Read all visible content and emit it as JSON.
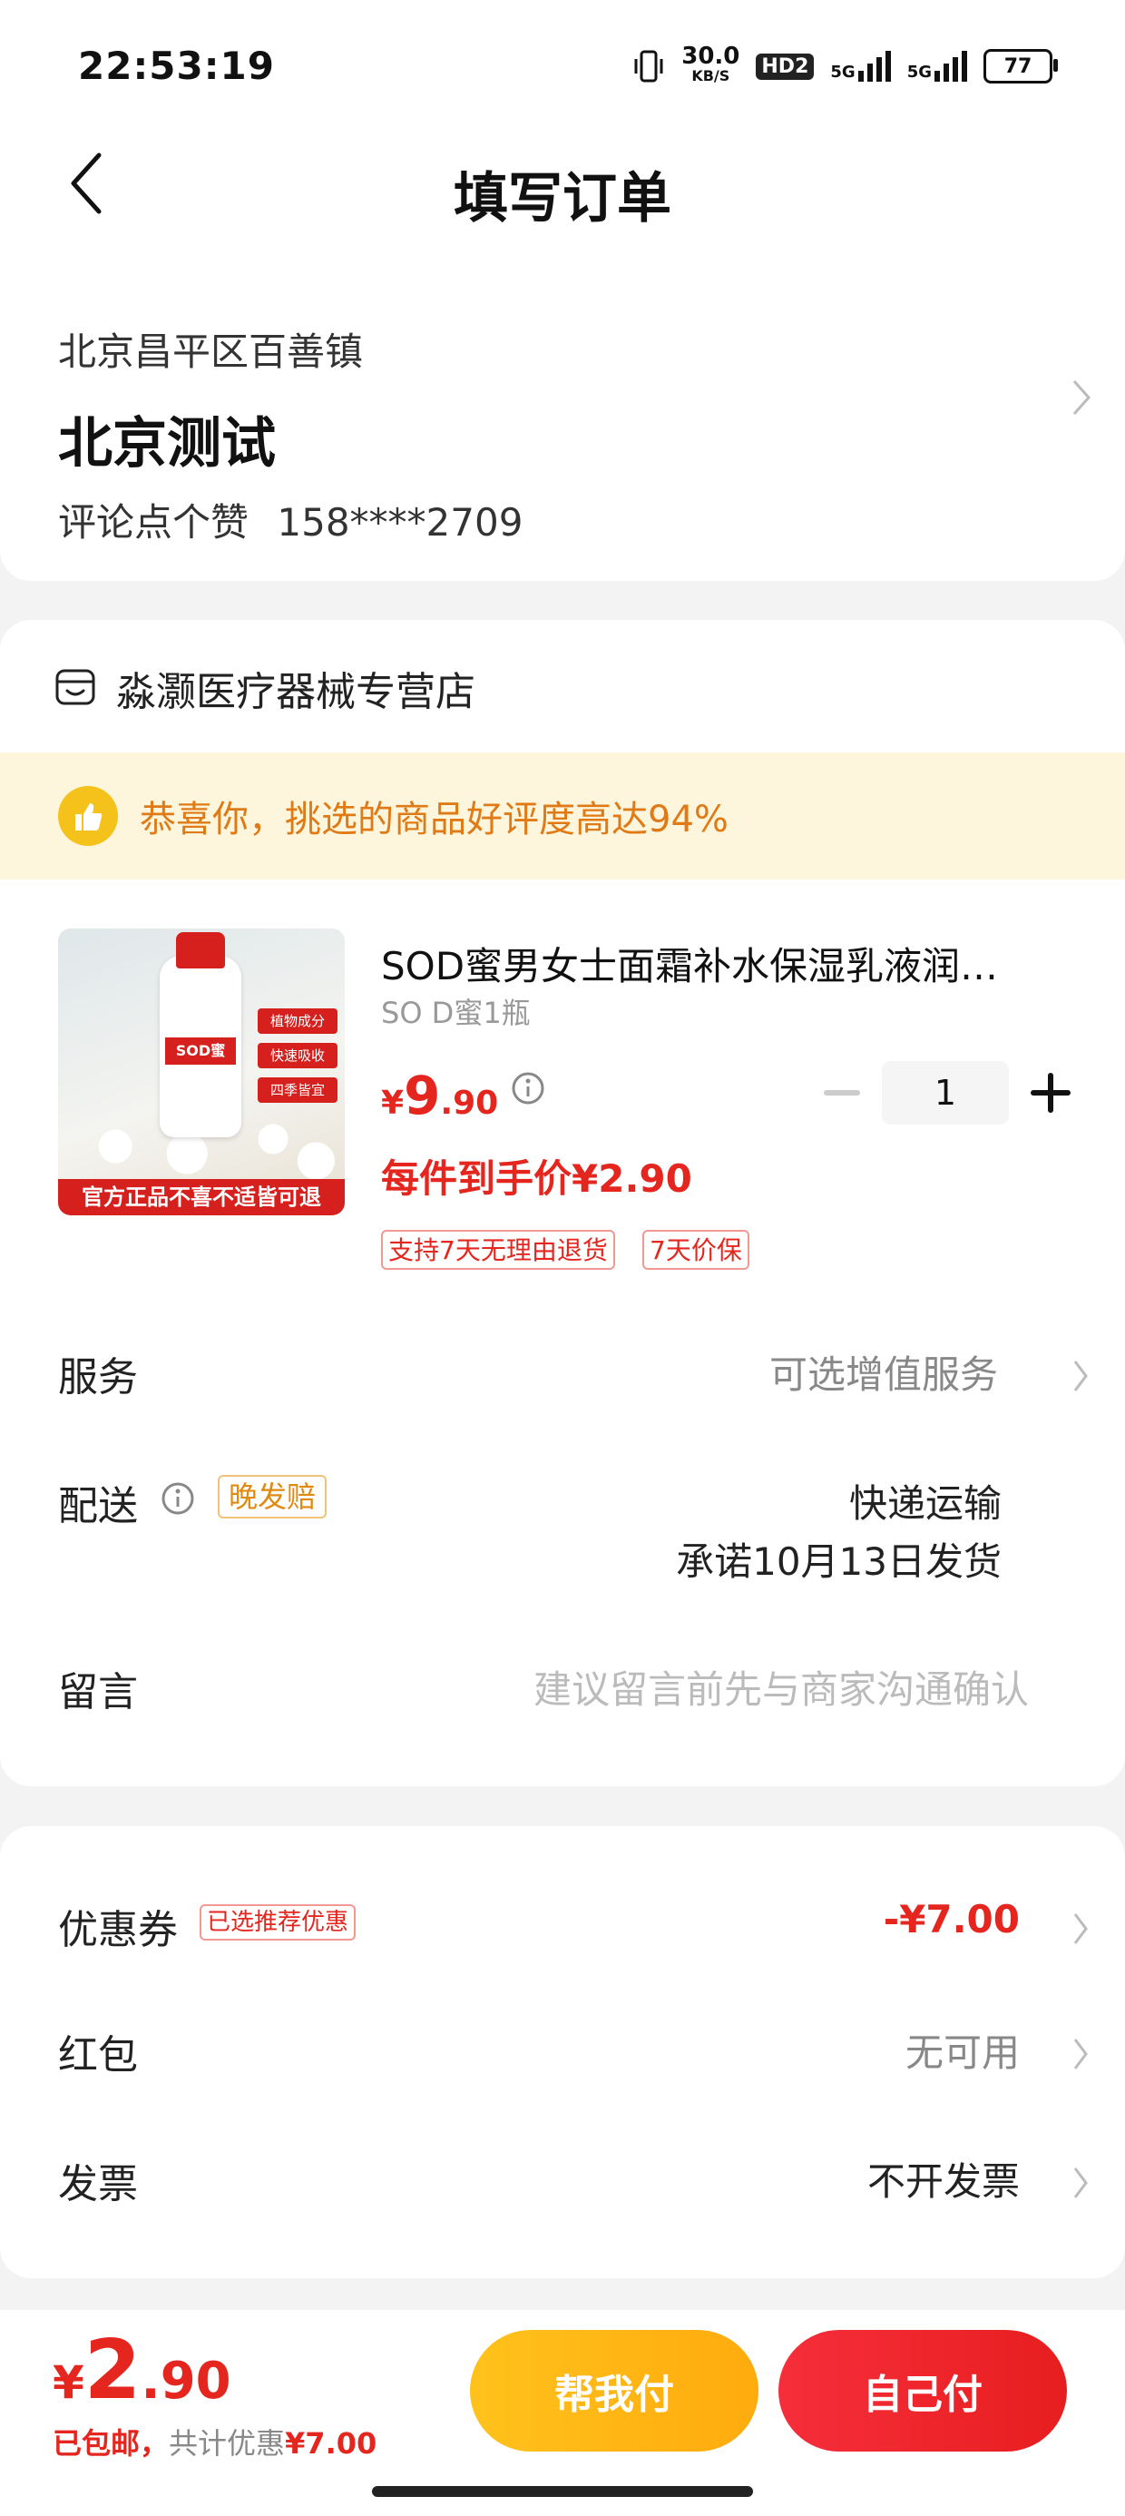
{
  "status_bar": {
    "time": "22:53:19",
    "net_speed_value": "30.0",
    "net_speed_unit": "KB/S",
    "hd_label": "HD2",
    "signal_1_label": "5G",
    "signal_2_label": "5G",
    "battery": "77"
  },
  "nav": {
    "title": "填写订单"
  },
  "address": {
    "region": "北京昌平区百善镇",
    "name": "北京测试",
    "contact_name": "评论点个赞",
    "phone": "158****2709"
  },
  "shop": {
    "name": "淼灏医疗器械专营店"
  },
  "promo": {
    "text": "恭喜你，挑选的商品好评度高达94%"
  },
  "product": {
    "title": "SOD蜜男女士面霜补水保湿乳液润…",
    "spec": "SO D蜜1瓶",
    "price_currency": "¥",
    "price_int": "9",
    "price_dec": ".90",
    "quantity": "1",
    "unit_price_text": "每件到手价¥2.90",
    "tags": [
      "支持7天无理由退货",
      "7天价保"
    ],
    "image_label": "SOD蜜",
    "image_chips": [
      "植物成分",
      "快速吸收",
      "四季皆宜"
    ],
    "image_caption": "官方正品不喜不适皆可退"
  },
  "service": {
    "label": "服务",
    "value": "可选增值服务"
  },
  "delivery": {
    "label": "配送",
    "badge": "晚发赔",
    "method": "快递运输",
    "promise": "承诺10月13日发货"
  },
  "message": {
    "label": "留言",
    "placeholder": "建议留言前先与商家沟通确认"
  },
  "coupon": {
    "label": "优惠券",
    "badge": "已选推荐优惠",
    "value": "-¥7.00"
  },
  "red_packet": {
    "label": "红包",
    "value": "无可用"
  },
  "invoice": {
    "label": "发票",
    "value": "不开发票"
  },
  "bottom": {
    "currency": "¥",
    "total_int": "2",
    "total_dec": ".90",
    "shipping": "已包邮，",
    "discount_label": "共计优惠",
    "discount_value": "¥7.00",
    "help_pay": "帮我付",
    "self_pay": "自己付"
  },
  "colors": {
    "accent_red": "#e5261f",
    "promo_orange": "#e07a16",
    "help_button": "#ffb715",
    "self_button": "#ef2630"
  }
}
